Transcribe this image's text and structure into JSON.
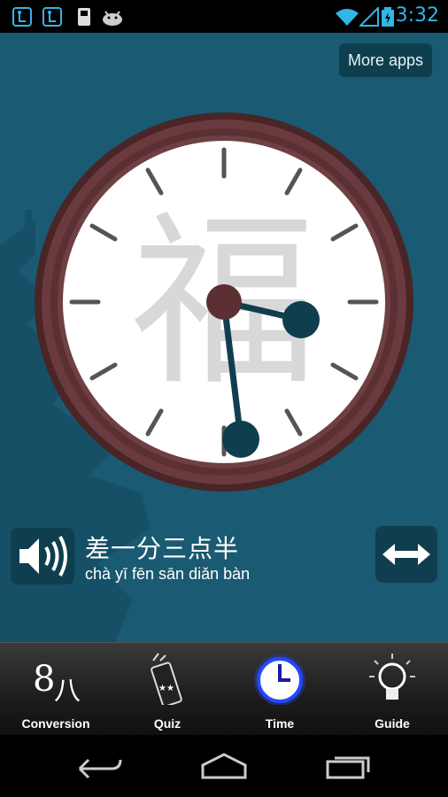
{
  "status_bar": {
    "time": "3:32",
    "icons": [
      "usb-debug-icon",
      "usb-debug-icon",
      "sd-card-icon",
      "android-icon",
      "wifi-icon",
      "signal-icon",
      "battery-icon"
    ]
  },
  "header": {
    "more_apps_label": "More apps"
  },
  "clock": {
    "background_character": "福",
    "time_shown": "3:32"
  },
  "phrase": {
    "hanzi": "差一分三点半",
    "pinyin": "chà yī fēn sān diǎn bàn"
  },
  "nav": {
    "items": [
      {
        "label": "Conversion",
        "icon": "number-8-icon"
      },
      {
        "label": "Quiz",
        "icon": "firecracker-icon"
      },
      {
        "label": "Time",
        "icon": "clock-icon"
      },
      {
        "label": "Guide",
        "icon": "lightbulb-icon"
      }
    ],
    "active": "Time"
  },
  "colors": {
    "background": "#1a5a72",
    "button_bg": "#0f3f4f",
    "clock_rim": "#5b3033",
    "clock_hand": "#0f3f4f",
    "active_glow": "#3b5bff",
    "status_accent": "#33b5e5"
  }
}
